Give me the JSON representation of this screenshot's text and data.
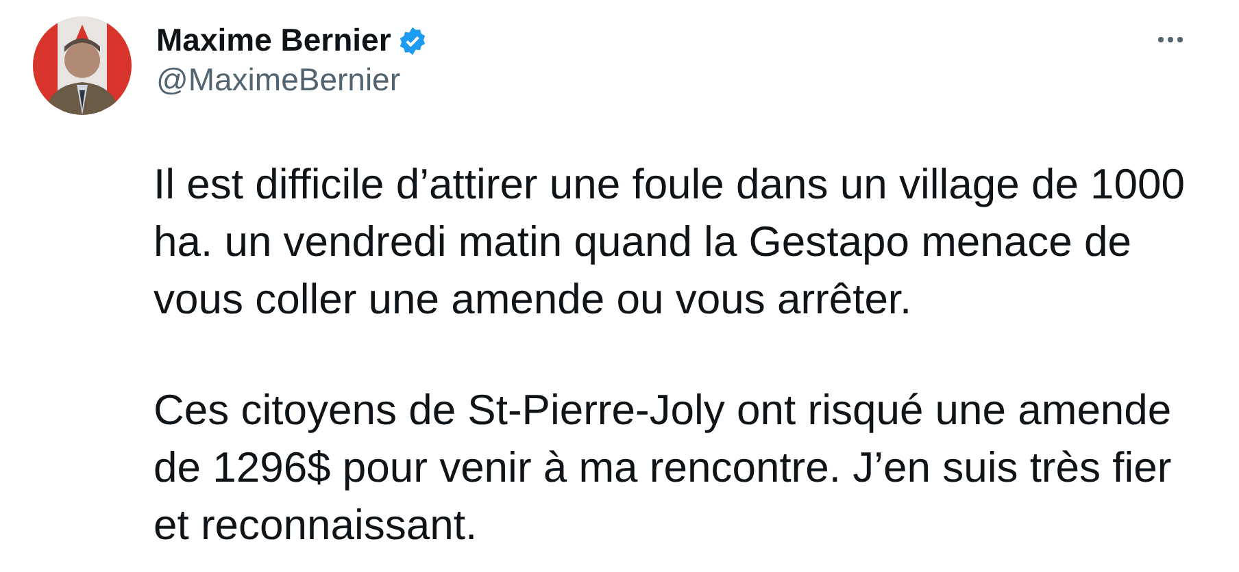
{
  "author": {
    "name": "Maxime Bernier",
    "verified": true,
    "handle": "@MaximeBernier"
  },
  "paragraphs": [
    "Il est difficile d’attirer une foule dans un village de 1000\nha. un vendredi matin quand la Gestapo menace de\nvous coller une amende ou vous arrêter.",
    "Ces citoyens de St-Pierre-Joly ont risqué une amende\nde 1296$ pour venir à ma rencontre. J’en suis très fier\net reconnaissant."
  ]
}
